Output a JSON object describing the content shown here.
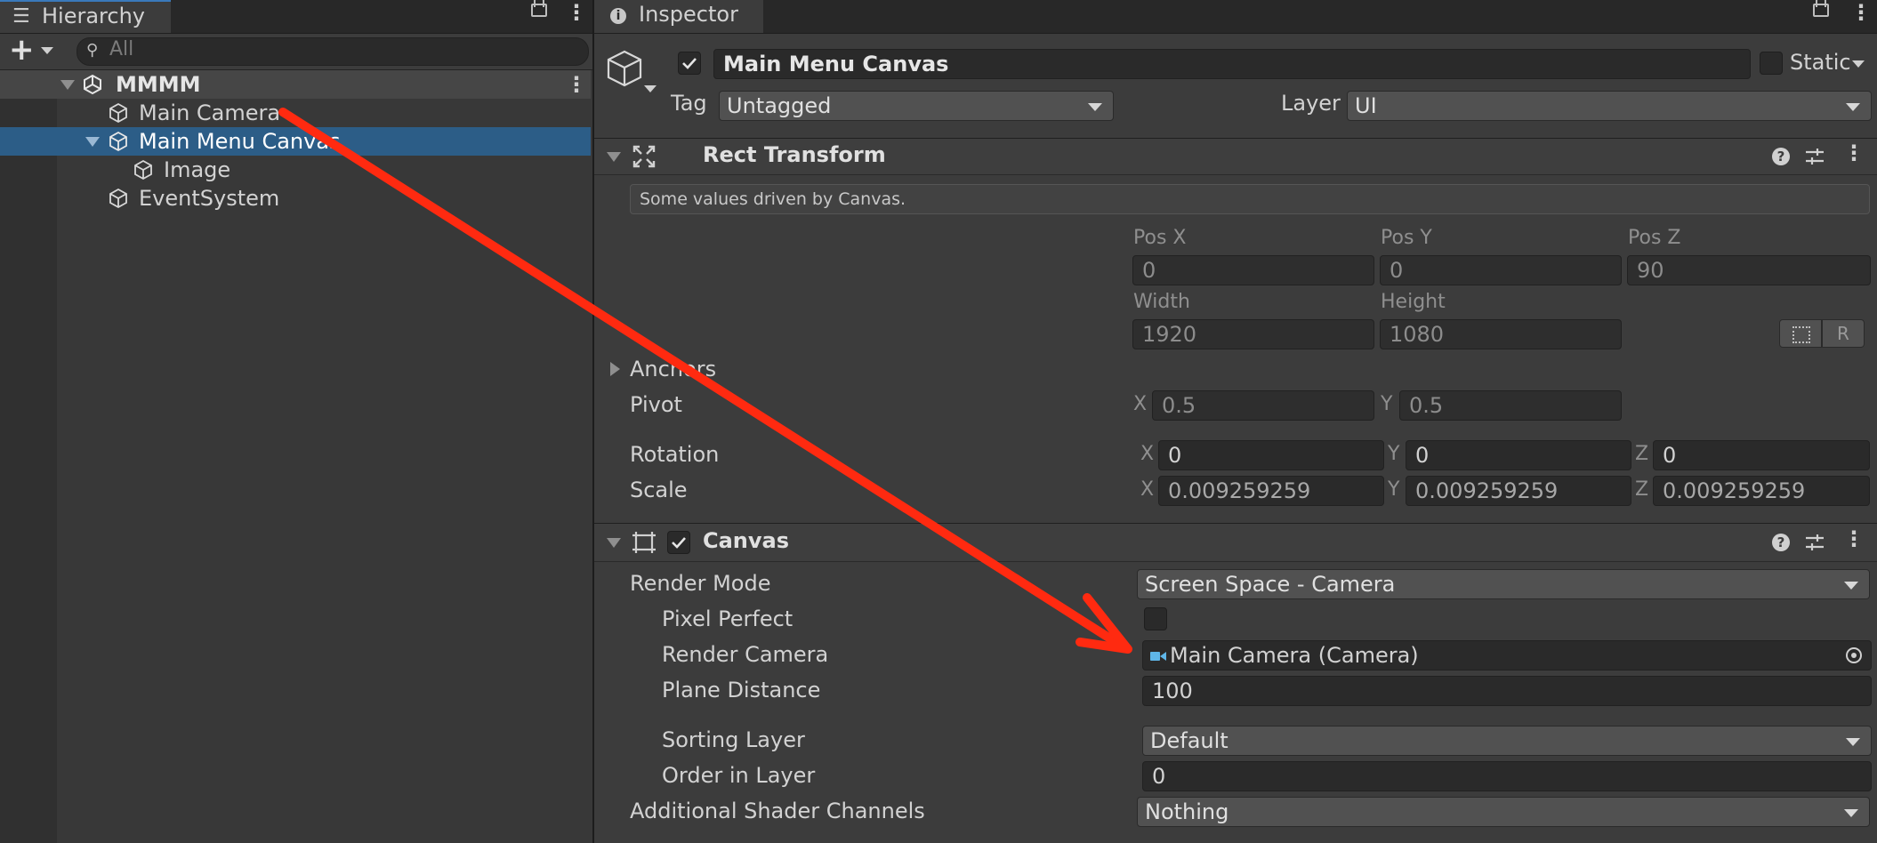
{
  "hierarchy": {
    "tab_label": "Hierarchy",
    "search_placeholder": "All",
    "scene_name": "MMMM",
    "items": [
      {
        "label": "Main Camera"
      },
      {
        "label": "Main Menu Canvas"
      },
      {
        "label": "Image"
      },
      {
        "label": "EventSystem"
      }
    ]
  },
  "inspector": {
    "tab_label": "Inspector",
    "object_name": "Main Menu Canvas",
    "static_label": "Static",
    "tag_label": "Tag",
    "tag_value": "Untagged",
    "layer_label": "Layer",
    "layer_value": "UI"
  },
  "rect_transform": {
    "title": "Rect Transform",
    "info": "Some values driven by Canvas.",
    "pos_x_label": "Pos X",
    "pos_x": "0",
    "pos_y_label": "Pos Y",
    "pos_y": "0",
    "pos_z_label": "Pos Z",
    "pos_z": "90",
    "width_label": "Width",
    "width": "1920",
    "height_label": "Height",
    "height": "1080",
    "r_button": "R",
    "anchors_label": "Anchors",
    "pivot_label": "Pivot",
    "pivot_x": "0.5",
    "pivot_y": "0.5",
    "rotation_label": "Rotation",
    "rot_x": "0",
    "rot_y": "0",
    "rot_z": "0",
    "scale_label": "Scale",
    "scale_x": "0.009259259",
    "scale_y": "0.009259259",
    "scale_z": "0.009259259",
    "x": "X",
    "y": "Y",
    "z": "Z"
  },
  "canvas": {
    "title": "Canvas",
    "render_mode_label": "Render Mode",
    "render_mode_value": "Screen Space - Camera",
    "pixel_perfect_label": "Pixel Perfect",
    "render_camera_label": "Render Camera",
    "render_camera_value": "Main Camera (Camera)",
    "plane_distance_label": "Plane Distance",
    "plane_distance_value": "100",
    "sorting_layer_label": "Sorting Layer",
    "sorting_layer_value": "Default",
    "order_in_layer_label": "Order in Layer",
    "order_in_layer_value": "0",
    "additional_shader_label": "Additional Shader Channels",
    "additional_shader_value": "Nothing"
  },
  "colors": {
    "annotation_arrow": "#ff2a10",
    "selection": "#2c5d87",
    "panel_bg": "#383838"
  }
}
